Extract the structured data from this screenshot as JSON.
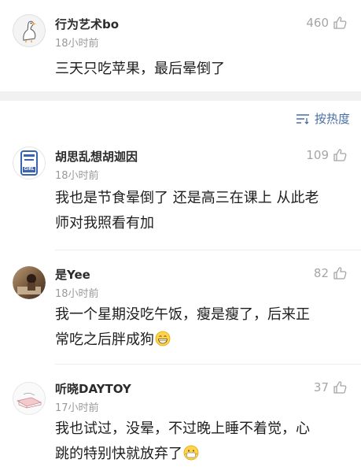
{
  "top_comment": {
    "username": "行为艺术bo",
    "time": "18小时前",
    "likes": "460",
    "text": "三天只吃苹果，最后晕倒了"
  },
  "sort": {
    "label": "按热度",
    "icon": "sort-lines-icon",
    "color": "#4a6fa3"
  },
  "comments": [
    {
      "username": "胡思乱想胡迦因",
      "time": "18小时前",
      "likes": "109",
      "line1": "我也是节食晕倒了 还是高三在课上 从此老",
      "line2": "师对我照看有加",
      "avatar_text": "GIRL"
    },
    {
      "username": "是Yee",
      "time": "18小时前",
      "likes": "82",
      "line1": "我一个星期没吃午饭，瘦是瘦了，后来正",
      "line2": "常吃之后胖成狗",
      "emoji": "grin-emoji-icon"
    },
    {
      "username": "听晓DAYTOY",
      "time": "17小时前",
      "likes": "37",
      "line1": "我也试过，没晕，不过晚上睡不着觉，心",
      "line2": "跳的特别快就放弃了",
      "emoji": "mask-emoji-icon"
    }
  ]
}
